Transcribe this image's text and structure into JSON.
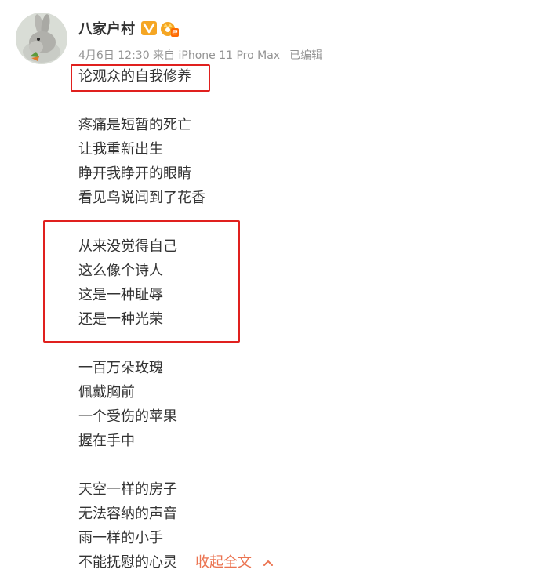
{
  "author": {
    "name": "八家户村",
    "verified_icon": "verified-v-badge-icon",
    "member_icon": "member-level-crown-icon",
    "badge_color": "#f5a623"
  },
  "meta": {
    "time": "4月6日 12:30 来自 iPhone 11 Pro Max",
    "edited": "已编辑"
  },
  "post": {
    "title": "论观众的自我修养",
    "stanzas": [
      [
        "疼痛是短暂的死亡",
        "让我重新出生",
        "睁开我睁开的眼睛",
        "看见鸟说闻到了花香"
      ],
      [
        "从来没觉得自己",
        "这么像个诗人",
        "这是一种耻辱",
        "还是一种光荣"
      ],
      [
        "一百万朵玫瑰",
        "佩戴胸前",
        "一个受伤的苹果",
        "握在手中"
      ],
      [
        "天空一样的房子",
        "无法容纳的声音",
        "雨一样的小手",
        "不能抚慰的心灵"
      ]
    ],
    "collapse_label": "收起全文",
    "collapse_icon": "chevron-up-icon"
  },
  "colors": {
    "text": "#333333",
    "meta": "#939393",
    "link": "#eb7350",
    "highlight_box": "#e0201e"
  }
}
